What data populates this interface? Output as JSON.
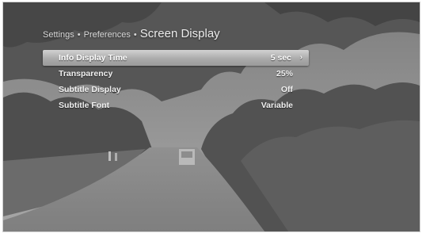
{
  "breadcrumb": {
    "crumbs": [
      "Settings",
      "Preferences"
    ],
    "separator": "•",
    "current": "Screen Display"
  },
  "menu": {
    "items": [
      {
        "label": "Info Display Time",
        "value": "5 sec",
        "selected": true
      },
      {
        "label": "Transparency",
        "value": "25%"
      },
      {
        "label": "Subtitle Display",
        "value": "Off"
      },
      {
        "label": "Subtitle Font",
        "value": "Variable"
      }
    ],
    "selected_arrow_icon": "chevron-right-icon"
  },
  "colors": {
    "highlight": "#bdbdbd",
    "text": "#f1f1f1",
    "breadcrumb_text": "#d9d9d9"
  }
}
